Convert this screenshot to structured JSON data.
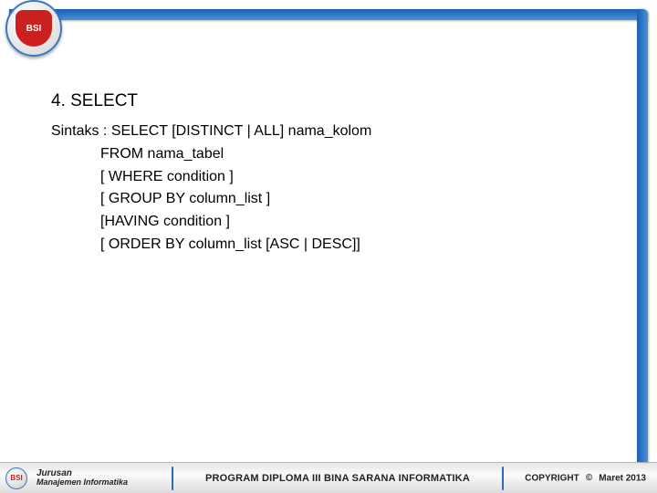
{
  "logo": {
    "text": "BSI"
  },
  "slide": {
    "heading": "4.  SELECT",
    "syntax_label": "Sintaks : ",
    "lines": [
      "SELECT [DISTINCT | ALL] nama_kolom",
      "FROM nama_tabel",
      "[ WHERE condition ]",
      "[ GROUP BY column_list ]",
      "[HAVING condition ]",
      "[ ORDER BY column_list [ASC | DESC]]"
    ]
  },
  "footer": {
    "dept_line1": "Jurusan",
    "dept_line2": "Manajemen Informatika",
    "center": "PROGRAM DIPLOMA III BINA SARANA INFORMATIKA",
    "copyright_word": "COPYRIGHT",
    "copyright_symbol": "©",
    "date": "Maret 2013",
    "small_logo": "BSI"
  }
}
